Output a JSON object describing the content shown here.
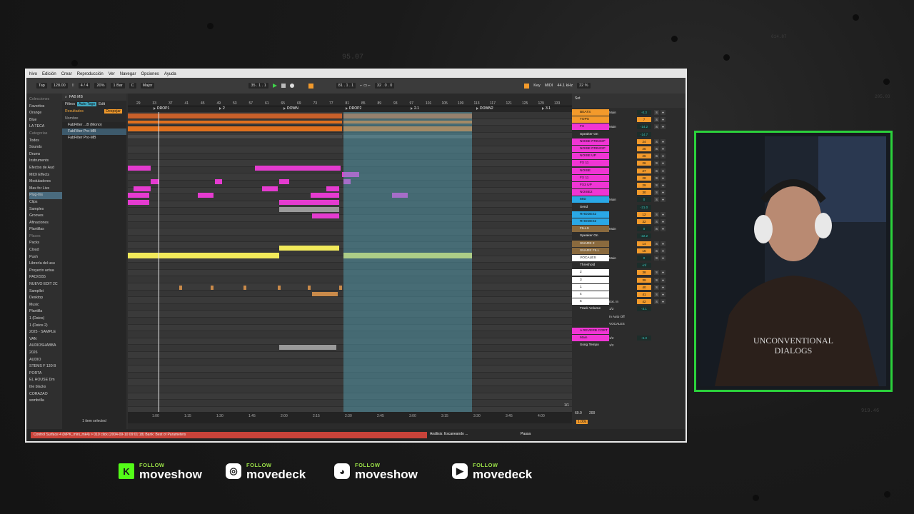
{
  "background_numbers": [
    "95.07",
    "614.87",
    "205.03",
    "919.46"
  ],
  "menu": [
    "hivo",
    "Edición",
    "Crear",
    "Reproducción",
    "Ver",
    "Navegar",
    "Opciones",
    "Ayuda"
  ],
  "transport": {
    "tap": "Tap",
    "tempo": "128.00",
    "signature": "4 / 4",
    "zoom": "20%",
    "quantize": "1 Bar",
    "key": "C",
    "scale": "Major",
    "position": "35 . 1 . 1",
    "loop_start": "81 . 1 . 1",
    "loop_length": "32 . 0 . 0",
    "key_label": "Key",
    "midi_label": "MIDI",
    "sample_rate": "44.1 kHz",
    "cpu": "22 %"
  },
  "browser": {
    "search_value": "FAB MB",
    "filter_label": "Filtros",
    "autotags_label": "Auto Tags",
    "edit_label": "Edit",
    "results_label": "Resultados",
    "clear_label": "Despejar",
    "name_header": "Nombre",
    "sidebar": [
      "Colecciones",
      "Favoritos",
      "Orange",
      "Blue",
      "LA TECA",
      "Categorías",
      "Todos",
      "Sounds",
      "Drums",
      "Instruments",
      "Efectos de Aud",
      "MIDI Effects",
      "Moduladores",
      "Max for Live",
      "Plug-Ins",
      "Clips",
      "Samples",
      "Grooves",
      "Afinaciones",
      "Plantillas",
      "Places",
      "Packs",
      "Cloud",
      "Push",
      "Librería del usu",
      "Proyecto actua",
      "PACKS55",
      "NUEVO EDIT 2C",
      "Sampllst",
      "Desktop",
      "Music",
      "Plantilla",
      "1 (Datos)",
      "1 (Datos 2)",
      "2025 - SAMPLE",
      "VAN",
      "AUDIOSHABBA",
      "2026",
      "AUDIO",
      "STEMS F 130 B",
      "PORTA",
      "EL HOUSE Dm",
      "the blacks",
      "CORAZAO",
      "sombrilla"
    ],
    "files": [
      "FabFilter ...B (Mono)",
      "FabFilter Pro-MB",
      "FabFilter Pro-MB"
    ],
    "selected_info": "1 item selected"
  },
  "arrangement": {
    "ruler": [
      "29",
      "33",
      "37",
      "41",
      "45",
      "49",
      "53",
      "57",
      "61",
      "65",
      "69",
      "73",
      "77",
      "81",
      "85",
      "89",
      "93",
      "97",
      "101",
      "105",
      "109",
      "113",
      "117",
      "121",
      "125",
      "129",
      "133"
    ],
    "locators": [
      "DROP1",
      "2",
      "DOWN",
      "DROP2",
      "2.1",
      "DOWN2",
      "3.1"
    ],
    "times": [
      "1:00",
      "1:15",
      "1:30",
      "1:45",
      "2:00",
      "2:15",
      "2:30",
      "2:45",
      "3:00",
      "3:15",
      "3:30",
      "3:45",
      "4:00"
    ],
    "fraction": "1/1"
  },
  "mixer": {
    "set_label": "Set",
    "tracks": [
      {
        "name": "BEATS",
        "color": "#f39a2b",
        "route": "Main",
        "vol": "3",
        "db": "-0.3"
      },
      {
        "name": "TOPS",
        "color": "#f39a2b",
        "route": "",
        "vol": "7",
        "db": ""
      },
      {
        "name": "FX",
        "color": "#f035d4",
        "route": "Main",
        "vol": "22",
        "db": "-14.2"
      },
      {
        "name": "Speaker On",
        "color": "",
        "route": "",
        "vol": "",
        "db": "-14.7"
      },
      {
        "name": "NOISE PRINCIP",
        "color": "#f035d4",
        "route": "",
        "vol": "24",
        "db": ""
      },
      {
        "name": "NOISE PRINCIP",
        "color": "#f035d4",
        "route": "",
        "vol": "25",
        "db": ""
      },
      {
        "name": "NOISE UP",
        "color": "#f035d4",
        "route": "",
        "vol": "26",
        "db": ""
      },
      {
        "name": "FX 11",
        "color": "#f035d4",
        "route": "",
        "vol": "26",
        "db": ""
      },
      {
        "name": "NOISE",
        "color": "#f035d4",
        "route": "",
        "vol": "27",
        "db": ""
      },
      {
        "name": "FX 11",
        "color": "#f035d4",
        "route": "",
        "vol": "28",
        "db": ""
      },
      {
        "name": "FX3 UP",
        "color": "#f035d4",
        "route": "",
        "vol": "29",
        "db": ""
      },
      {
        "name": "NOISE2",
        "color": "#f035d4",
        "route": "",
        "vol": "30",
        "db": ""
      },
      {
        "name": "MID",
        "color": "#2aa8e6",
        "route": "Main",
        "vol": "12",
        "db": "0"
      },
      {
        "name": "Send",
        "color": "",
        "route": "",
        "vol": "",
        "db": "-21.0"
      },
      {
        "name": "RHODES2",
        "color": "#2aa8e6",
        "route": "",
        "vol": "12",
        "db": ""
      },
      {
        "name": "RHODES2",
        "color": "#2aa8e6",
        "route": "",
        "vol": "32",
        "db": ""
      },
      {
        "name": "FILLS",
        "color": "#8a6a3e",
        "route": "Main",
        "vol": "13",
        "db": "0"
      },
      {
        "name": "Speaker On",
        "color": "",
        "route": "",
        "vol": "",
        "db": "-22.2"
      },
      {
        "name": "SNARE 2",
        "color": "#8a6a3e",
        "route": "",
        "vol": "14",
        "db": ""
      },
      {
        "name": "SNARE FILL",
        "color": "#8a6a3e",
        "route": "",
        "vol": "15",
        "db": ""
      },
      {
        "name": "VOCALES",
        "color": "#ffffff",
        "route": "Main",
        "vol": "36",
        "db": "0"
      },
      {
        "name": "Threshold",
        "color": "",
        "route": "",
        "vol": "",
        "db": "-inf"
      },
      {
        "name": "2",
        "color": "#ffffff",
        "route": "",
        "vol": "38",
        "db": ""
      },
      {
        "name": "3",
        "color": "#ffffff",
        "route": "",
        "vol": "39",
        "db": ""
      },
      {
        "name": "1",
        "color": "#ffffff",
        "route": "",
        "vol": "40",
        "db": ""
      },
      {
        "name": "4",
        "color": "#ffffff",
        "route": "",
        "vol": "41",
        "db": ""
      },
      {
        "name": "5",
        "color": "#ffffff",
        "route": "Ext. In",
        "vol": "42",
        "db": ""
      },
      {
        "name": "Track Volume",
        "color": "",
        "route": "1/2",
        "vol": "",
        "db": "-3.1"
      },
      {
        "name": "",
        "color": "",
        "route": "In Auto Off",
        "vol": "",
        "db": ""
      },
      {
        "name": "",
        "color": "",
        "route": "VOCALES",
        "vol": "",
        "db": ""
      },
      {
        "name": "A REVERB CORT",
        "color": "#f035d4",
        "route": "",
        "vol": "",
        "db": ""
      },
      {
        "name": "Main",
        "color": "#f035d4",
        "route": "1/2",
        "vol": "",
        "db": "-6.3"
      },
      {
        "name": "Song Tempo",
        "color": "",
        "route": "1/2",
        "vol": "",
        "db": ""
      }
    ],
    "tempo_val1": "60.0",
    "tempo_val2": "200",
    "zoom": "1.00x"
  },
  "status": {
    "left": "Control Surface 4 (MPK_mini_mk4) > 010 click (2004-09-10 09:01:18) Bank: Best of Parameters",
    "analysis": "Análisis: Escaneando ...",
    "pause": "Pausa"
  },
  "social": [
    {
      "follow": "FOLLOW",
      "name": "moveshow",
      "icon": "kick-icon",
      "color": "#53fc18"
    },
    {
      "follow": "FOLLOW",
      "name": "movedeck",
      "icon": "instagram-icon",
      "color": "#ffffff"
    },
    {
      "follow": "FOLLOW",
      "name": "moveshow",
      "icon": "discord-icon",
      "color": "#ffffff"
    },
    {
      "follow": "FOLLOW",
      "name": "movedeck",
      "icon": "youtube-icon",
      "color": "#ffffff"
    }
  ]
}
